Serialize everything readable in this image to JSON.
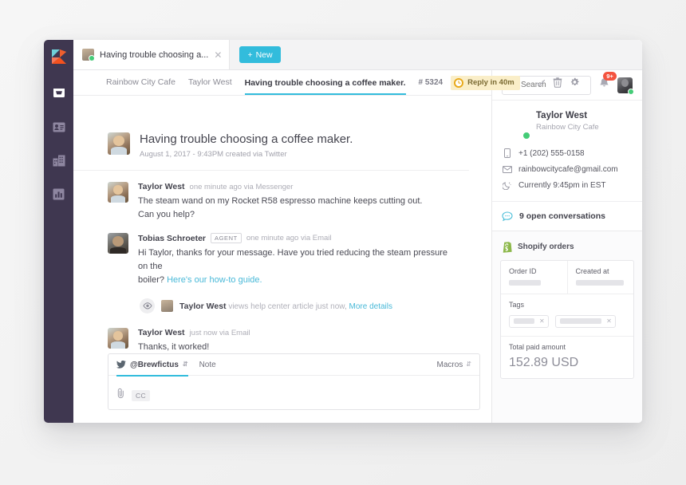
{
  "app": {
    "name": "Kayako",
    "logo_icon": "kayako-logo-icon"
  },
  "rail": {
    "items": [
      {
        "name": "inbox",
        "icon": "inbox-icon",
        "active": true
      },
      {
        "name": "contacts",
        "icon": "contact-card-icon",
        "active": false
      },
      {
        "name": "organizations",
        "icon": "building-icon",
        "active": false
      },
      {
        "name": "reports",
        "icon": "bar-chart-icon",
        "active": false
      }
    ]
  },
  "tabbar": {
    "tab_title": "Having trouble choosing a...",
    "close_icon": "close-icon",
    "new_button": "New",
    "new_icon": "plus-icon"
  },
  "topbar": {
    "search_placeholder": "Search",
    "search_value": "",
    "search_icon": "search-icon",
    "bell_icon": "bell-icon",
    "notification_count": "9+",
    "avatar": "user-avatar"
  },
  "breadcrumb": {
    "items": [
      {
        "label": "Rainbow City Cafe",
        "active": false
      },
      {
        "label": "Taylor West",
        "active": false
      },
      {
        "label": "Having trouble choosing a coffee maker.",
        "active": true
      }
    ]
  },
  "toolbar": {
    "ticket_number": "# 5324",
    "sla_label": "Reply in 40m",
    "sla_icon": "clock-icon",
    "check_icon": "check-icon",
    "trash_icon": "trash-icon",
    "gear_icon": "gear-icon"
  },
  "thread": {
    "subject": "Having trouble choosing a coffee maker.",
    "subject_meta": "August 1, 2017 - 9:43PM created via Twitter",
    "messages": [
      {
        "author": "Taylor West",
        "meta": "one minute ago via Messenger",
        "badge": "",
        "line1": "The steam wand on my Rocket R58 espresso machine keeps cutting out.",
        "line2": "Can you help?",
        "link": ""
      },
      {
        "author": "Tobias Schroeter",
        "meta": "one minute ago via Email",
        "badge": "AGENT",
        "line1": "Hi Taylor, thanks for your message. Have you tried reducing the steam pressure on the",
        "line2": "boiler? ",
        "link": "Here's our how-to guide."
      },
      {
        "author": "Taylor West",
        "meta": "just now via Email",
        "badge": "",
        "line1": "Thanks, it worked!",
        "line2": "",
        "link": ""
      }
    ],
    "event": {
      "eye_icon": "eye-icon",
      "actor": "Taylor West",
      "text": "views help center article just now,",
      "link": "More details"
    }
  },
  "composer": {
    "channel_icon": "twitter-icon",
    "channel_handle": "@Brewfictus",
    "channel_caret": "chevron-updown-icon",
    "note_label": "Note",
    "macros_label": "Macros",
    "macros_caret": "chevron-updown-icon",
    "attach_icon": "paperclip-icon",
    "cc_label": "CC",
    "body_value": "",
    "body_placeholder": ""
  },
  "sidebar": {
    "contact": {
      "name": "Taylor West",
      "org": "Rainbow City Cafe",
      "status": "online",
      "details": [
        {
          "icon": "phone-icon",
          "value": "+1 (202) 555-0158"
        },
        {
          "icon": "envelope-icon",
          "value": "rainbowcitycafe@gmail.com"
        },
        {
          "icon": "moon-icon",
          "value": "Currently 9:45pm in EST"
        }
      ]
    },
    "open_conversations": {
      "icon": "speech-bubble-icon",
      "label": "9 open conversations"
    },
    "app": {
      "icon": "shopify-icon",
      "title": "Shopify orders",
      "columns": [
        {
          "label": "Order ID",
          "value": ""
        },
        {
          "label": "Created at",
          "value": ""
        }
      ],
      "tags_label": "Tags",
      "tags": [
        {
          "value": ""
        },
        {
          "value": ""
        }
      ],
      "total_label": "Total paid amount",
      "total_value": "152.89 USD"
    }
  },
  "colors": {
    "rail_bg": "#3f3750",
    "accent": "#32bcdc",
    "badge_red": "#f4533f",
    "sla_bg": "#faeec8",
    "online_green": "#44cc77",
    "shopify_green": "#7cb342"
  }
}
